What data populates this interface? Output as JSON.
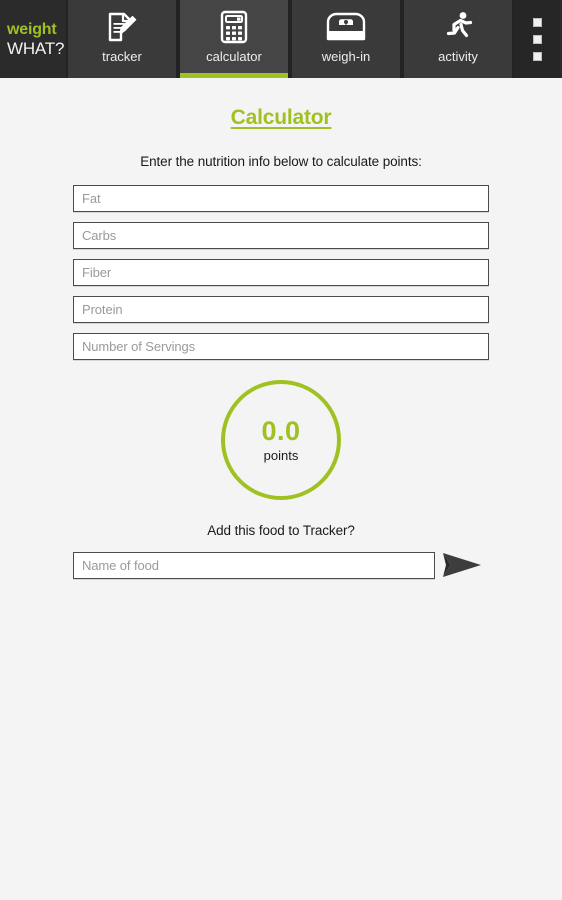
{
  "app": {
    "brand_line1": "weight",
    "brand_line2": "WHAT?",
    "brand_accent": "#9fc122",
    "topbar_bg": "#2b2b2b"
  },
  "tabs": [
    {
      "label": "tracker",
      "icon": "notepad-pencil-icon",
      "active": false
    },
    {
      "label": "calculator",
      "icon": "calculator-icon",
      "active": true
    },
    {
      "label": "weigh-in",
      "icon": "scale-icon",
      "active": false
    },
    {
      "label": "activity",
      "icon": "running-person-icon",
      "active": false
    }
  ],
  "overflow_menu": {
    "icon": "overflow-menu-icon",
    "dots": 3
  },
  "main": {
    "title": "Calculator",
    "subtitle": "Enter the nutrition info below to calculate points:",
    "fields": [
      {
        "name": "fat",
        "placeholder": "Fat",
        "value": ""
      },
      {
        "name": "carbs",
        "placeholder": "Carbs",
        "value": ""
      },
      {
        "name": "fiber",
        "placeholder": "Fiber",
        "value": ""
      },
      {
        "name": "protein",
        "placeholder": "Protein",
        "value": ""
      },
      {
        "name": "servings",
        "placeholder": "Number of Servings",
        "value": ""
      }
    ],
    "result": {
      "value": "0.0",
      "label": "points",
      "accent": "#9fc122"
    },
    "add_to_tracker": {
      "prompt": "Add this food to Tracker?",
      "food_placeholder": "Name of food",
      "food_value": "",
      "send_icon": "send-arrow-icon"
    }
  }
}
